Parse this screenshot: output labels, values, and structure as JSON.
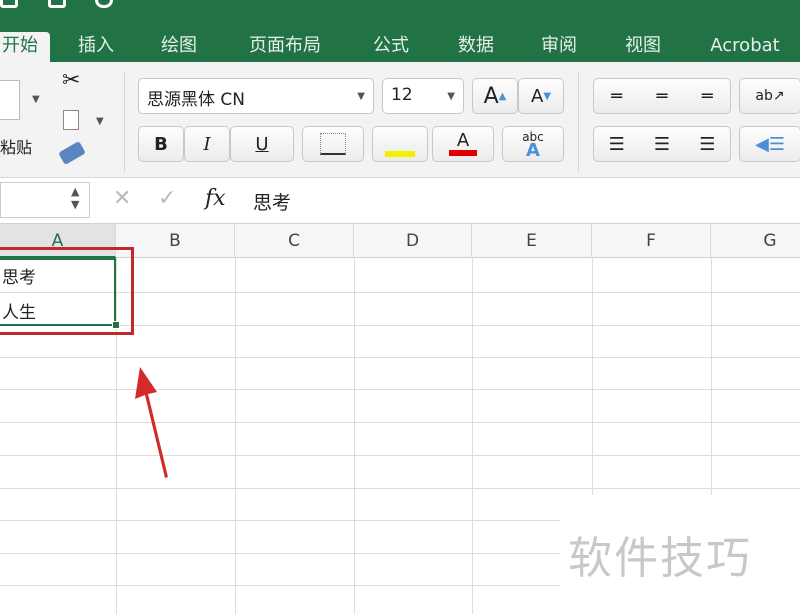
{
  "tabs": [
    "开始",
    "插入",
    "绘图",
    "页面布局",
    "公式",
    "数据",
    "审阅",
    "视图",
    "Acrobat"
  ],
  "ribbon": {
    "paste_label": "粘贴",
    "font_name": "思源黑体 CN",
    "font_size": "12",
    "bold": "B",
    "italic": "I",
    "underline": "U",
    "font_color": "#e00000",
    "fill_color": "#f5f000"
  },
  "formula_bar": {
    "fx": "fx",
    "value": "思考",
    "cancel": "✕",
    "enter": "✓"
  },
  "columns": [
    "A",
    "B",
    "C",
    "D",
    "E",
    "F",
    "G"
  ],
  "cells": {
    "A1": "思考",
    "A2": "人生"
  },
  "watermark": "软件技巧",
  "colors": {
    "excel_green": "#217346",
    "annotation_red": "#c0282e"
  }
}
